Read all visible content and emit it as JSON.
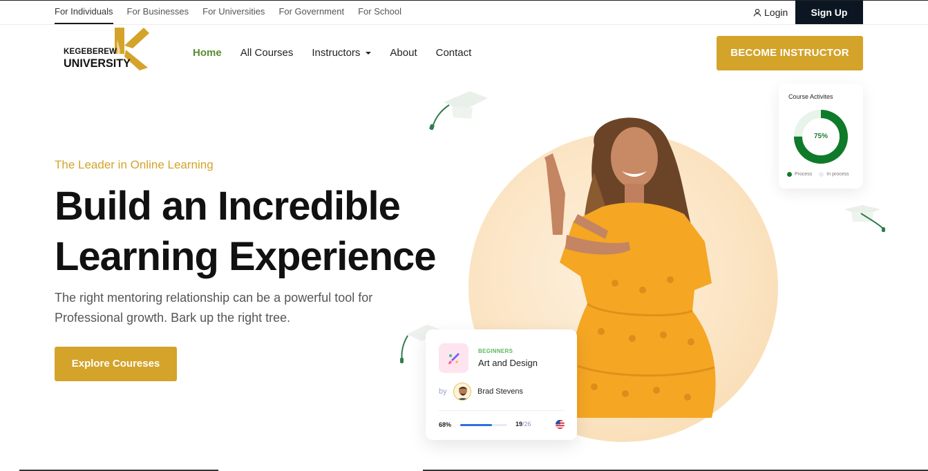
{
  "topbar": {
    "audience_tabs": [
      "For Individuals",
      "For Businesses",
      "For Universities",
      "For Government",
      "For School"
    ],
    "login_label": "Login",
    "signup_label": "Sign Up"
  },
  "logo": {
    "line1": "KEGEBEREW",
    "line2": "UNIVERSITY"
  },
  "nav": {
    "items": [
      "Home",
      "All Courses",
      "Instructors",
      "About",
      "Contact"
    ],
    "active": "Home",
    "become_instructor": "BECOME INSTRUCTOR"
  },
  "hero": {
    "tagline": "The Leader in Online Learning",
    "headline_line1": "Build an Incredible",
    "headline_line2": "Learning Experience",
    "subtext_line1": "The right mentoring relationship can be a powerful tool for",
    "subtext_line2": "Professional growth. Bark up the right tree.",
    "cta": "Explore Coureses"
  },
  "activity_card": {
    "title": "Course Activites",
    "percent_label": "75%",
    "percent": 0.75,
    "legend": [
      "Process",
      "In process"
    ]
  },
  "course_card": {
    "level": "BEGINNERS",
    "title": "Art and Design",
    "by": "by",
    "author": "Brad Stevens",
    "progress_label": "68%",
    "progress": 0.68,
    "lessons_done": "19",
    "lessons_total": "/26"
  },
  "colors": {
    "accent": "#d4a32a",
    "nav_active": "#5a8c2e",
    "dark": "#0b1622",
    "donut_green": "#0f7a2a",
    "progress_blue": "#2a6fe0"
  }
}
